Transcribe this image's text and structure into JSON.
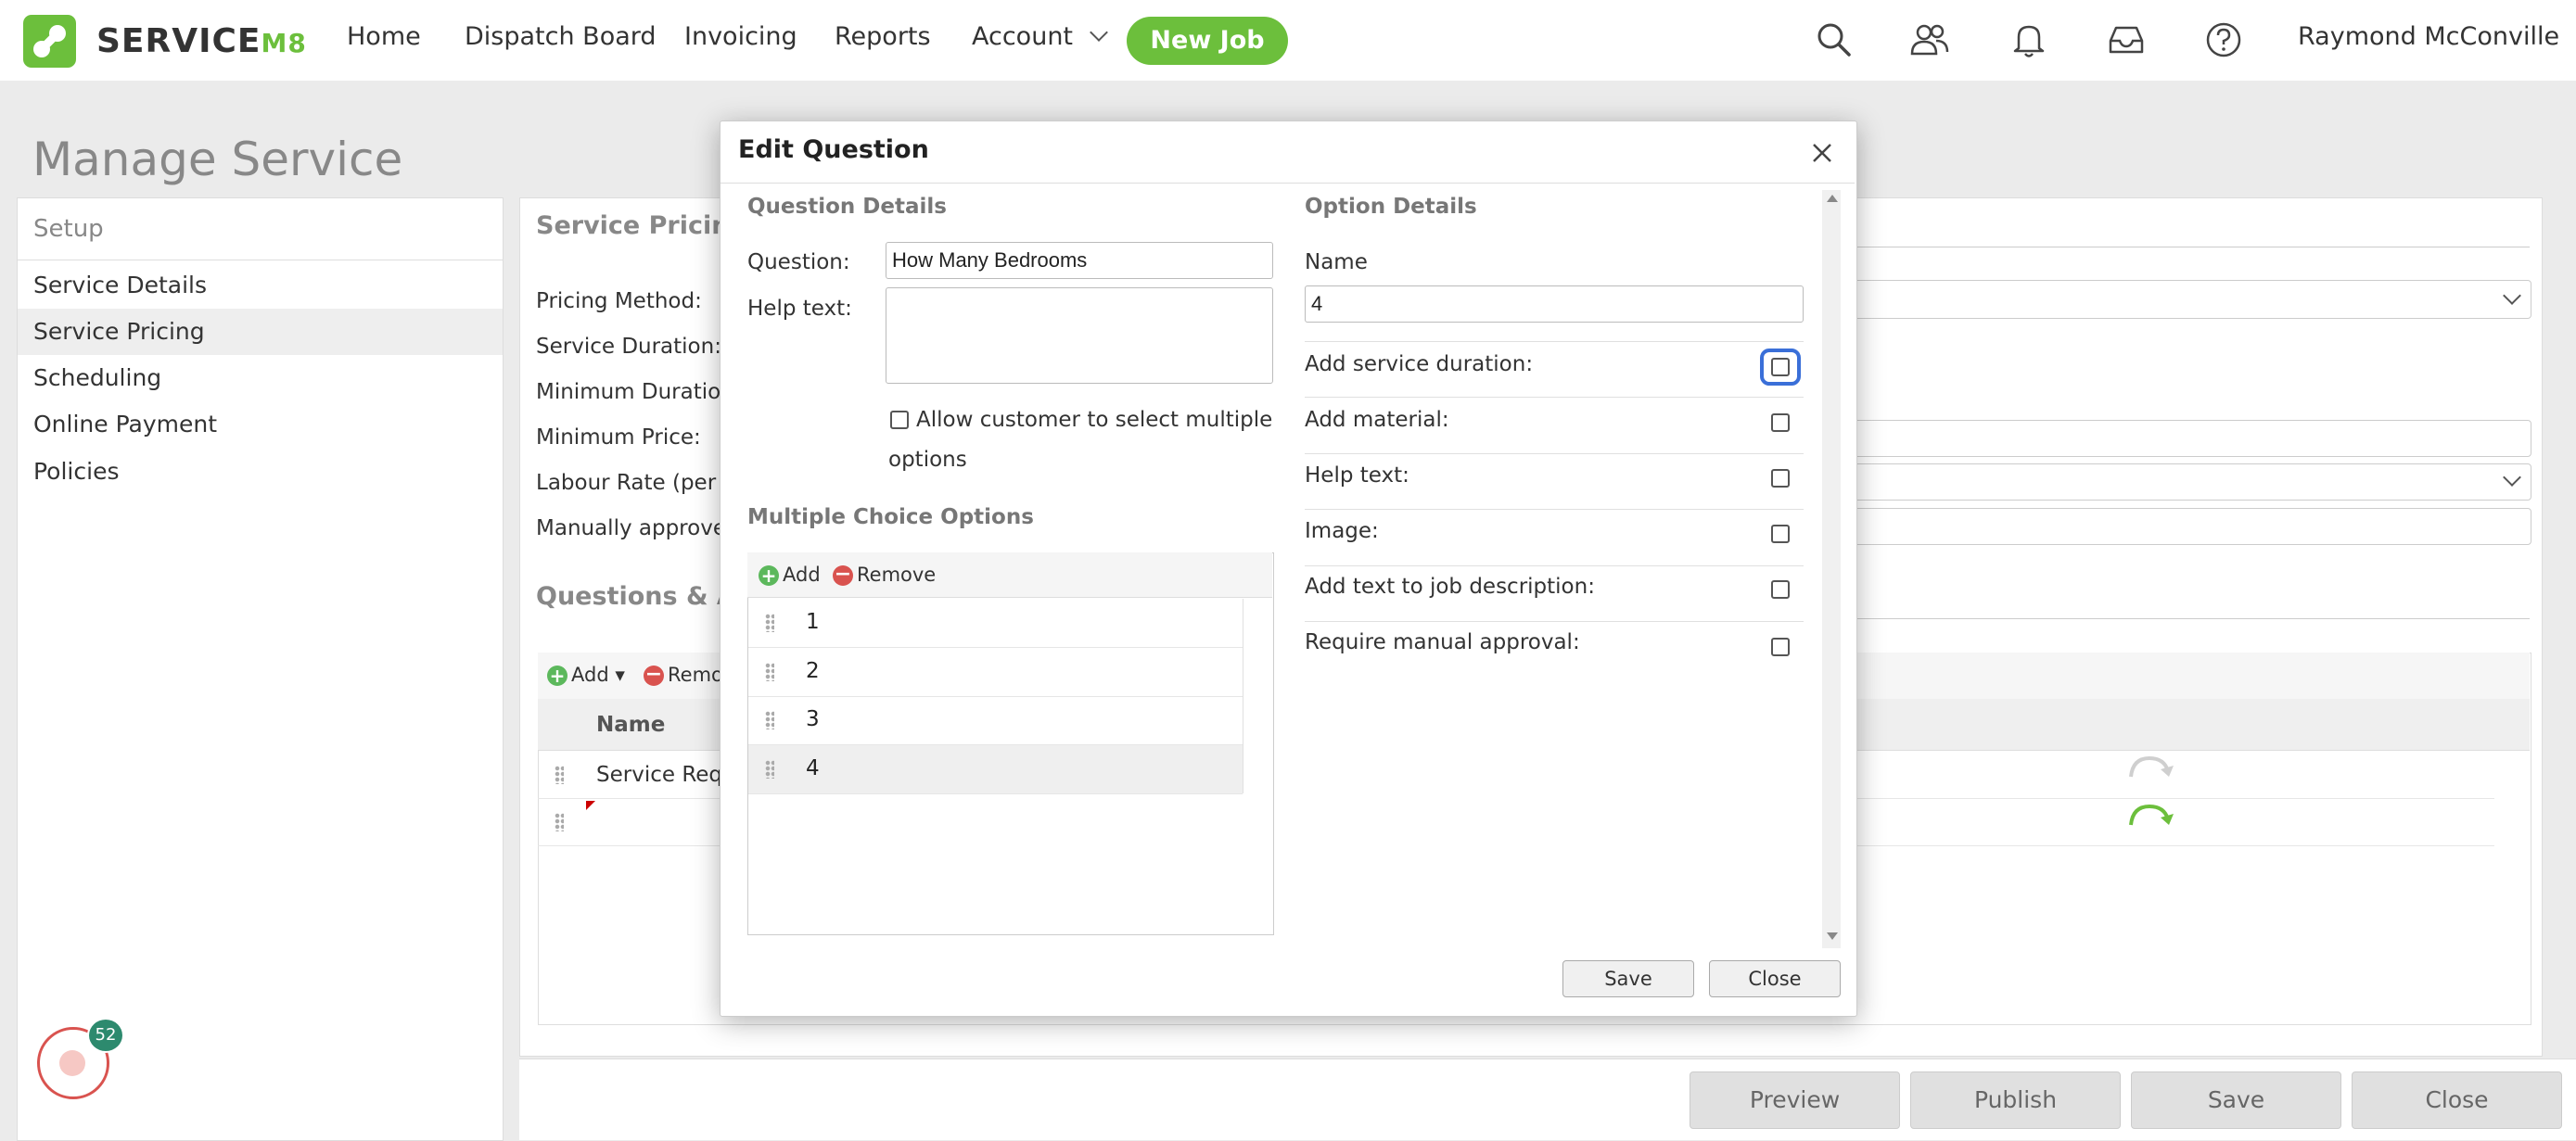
{
  "app": {
    "logo": "SERVICE",
    "logo_suffix": "M8"
  },
  "nav": {
    "home": "Home",
    "dispatch": "Dispatch Board",
    "invoicing": "Invoicing",
    "reports": "Reports",
    "account": "Account",
    "new_job": "New Job",
    "user": "Raymond McConville"
  },
  "page": {
    "title": "Manage Service"
  },
  "sidebar": {
    "header": "Setup",
    "items": [
      {
        "label": "Service Details"
      },
      {
        "label": "Service Pricing"
      },
      {
        "label": "Scheduling"
      },
      {
        "label": "Online Payment"
      },
      {
        "label": "Policies"
      }
    ],
    "notification_count": "52"
  },
  "main": {
    "section_pricing": "Service Pricing",
    "pricing_method": "Pricing Method:",
    "service_duration": "Service Duration:",
    "minimum_duration": "Minimum Duration:",
    "minimum_price": "Minimum Price:",
    "labour_rate": "Labour Rate (per hou",
    "manual_approve": "Manually approve jo",
    "section_questions": "Questions & Actio",
    "add": "Add",
    "remove": "Remo",
    "col_name": "Name",
    "row1_name": "Service Requi"
  },
  "bottom_actions": {
    "preview": "Preview",
    "publish": "Publish",
    "save": "Save",
    "close": "Close"
  },
  "modal": {
    "title": "Edit Question",
    "question_details": "Question Details",
    "question_label": "Question:",
    "question_value": "How Many Bedrooms",
    "help_label": "Help text:",
    "help_value": "",
    "allow_multiple_line1": "Allow customer to select multiple",
    "allow_multiple_line2": "options",
    "mc_title": "Multiple Choice Options",
    "mc_add": "Add",
    "mc_remove": "Remove",
    "options": [
      "1",
      "2",
      "3",
      "4"
    ],
    "option_details": "Option Details",
    "name_label": "Name",
    "name_value": "4",
    "opt_service_duration": "Add service duration:",
    "opt_material": "Add material:",
    "opt_help_text": "Help text:",
    "opt_image": "Image:",
    "opt_job_desc": "Add text to job description:",
    "opt_manual_approval": "Require manual approval:",
    "save": "Save",
    "close": "Close"
  },
  "colors": {
    "brand_green": "#6cbf3c",
    "focus_blue": "#3a6fd8",
    "danger_red": "#d9534f"
  }
}
